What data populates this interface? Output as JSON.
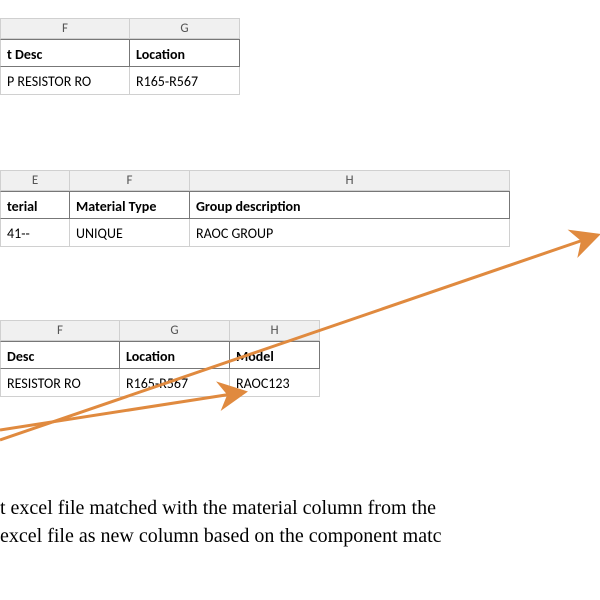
{
  "fragment1": {
    "col_letters": [
      "F",
      "G"
    ],
    "headers": [
      "t Desc",
      "Location"
    ],
    "row": [
      "P RESISTOR RO",
      "R165-R567"
    ]
  },
  "fragment2": {
    "col_letters": [
      "E",
      "F",
      "H"
    ],
    "headers": [
      "terial",
      "Material Type",
      "Group description"
    ],
    "row": [
      "41--",
      "UNIQUE",
      "RAOC GROUP"
    ]
  },
  "fragment3": {
    "col_letters": [
      "F",
      "G",
      "H"
    ],
    "headers": [
      "Desc",
      "Location",
      "Model"
    ],
    "row": [
      "RESISTOR RO",
      "R165-R567",
      "RAOC123"
    ]
  },
  "body_text": {
    "line1": "t excel file matched with the material column from the",
    "line2": "excel file as new column based on the component matc"
  }
}
